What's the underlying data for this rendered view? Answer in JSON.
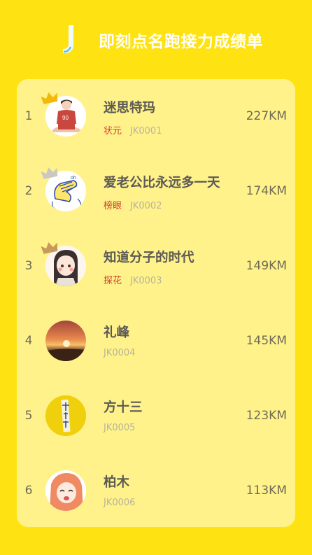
{
  "header": {
    "title": "即刻点名跑接力成绩单",
    "logo_icon": "jike-j-logo-icon"
  },
  "colors": {
    "background": "#ffe211",
    "card": "#fff28a",
    "title_text": "#ffffff",
    "tag_text": "#d0402e",
    "muted_text": "#b8b39c",
    "primary_text": "#5c5a55"
  },
  "leaderboard": [
    {
      "rank": "1",
      "name": "迷思特玛",
      "tag": "状元",
      "code": "JK0001",
      "distance": "227KM",
      "crown": "gold"
    },
    {
      "rank": "2",
      "name": "爱老公比永远多一天",
      "tag": "榜眼",
      "code": "JK0002",
      "distance": "174KM",
      "crown": "silver"
    },
    {
      "rank": "3",
      "name": "知道分子的时代",
      "tag": "探花",
      "code": "JK0003",
      "distance": "149KM",
      "crown": "bronze"
    },
    {
      "rank": "4",
      "name": "礼峰",
      "tag": "",
      "code": "JK0004",
      "distance": "145KM",
      "crown": ""
    },
    {
      "rank": "5",
      "name": "方十三",
      "tag": "",
      "code": "JK0005",
      "distance": "123KM",
      "crown": ""
    },
    {
      "rank": "6",
      "name": "柏木",
      "tag": "",
      "code": "JK0006",
      "distance": "113KM",
      "crown": ""
    }
  ]
}
